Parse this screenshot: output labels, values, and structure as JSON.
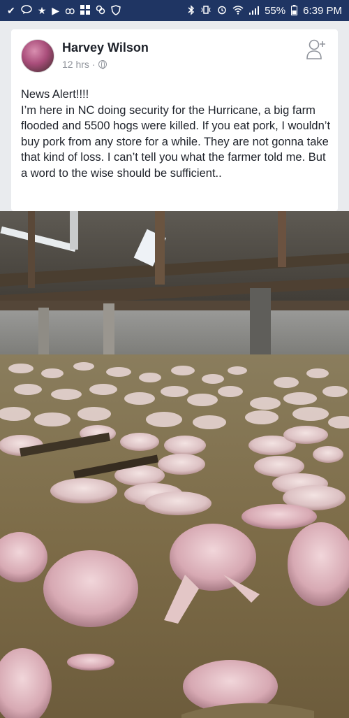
{
  "status_bar": {
    "battery_percent": "55%",
    "time": "6:39 PM",
    "icons_left": [
      "check-icon",
      "chat-icon",
      "star-icon",
      "play-icon",
      "voicemail-icon",
      "grid-app-icon",
      "link-icon",
      "shield-icon"
    ],
    "icons_right": [
      "bluetooth-icon",
      "vibrate-icon",
      "alarm-icon",
      "wifi-icon",
      "signal-icon",
      "battery-icon"
    ]
  },
  "post": {
    "author": "Harvey Wilson",
    "time": "12 hrs",
    "separator": "·",
    "audience_icon": "globe-icon",
    "text": "News Alert!!!!\nI’m here in NC doing security for the Hurricane, a big farm flooded and 5500 hogs were killed. If you eat pork, I wouldn’t buy pork from any store for a while. They are not gonna take that kind of loss. I can’t tell you what the farmer told me. But a word to the wise should be sufficient..",
    "action_icon": "add-friend-icon"
  },
  "colors": {
    "status_bar_bg": "#1f3563",
    "feed_bg": "#e9ebee",
    "text": "#1d2129",
    "meta": "#90949c"
  }
}
